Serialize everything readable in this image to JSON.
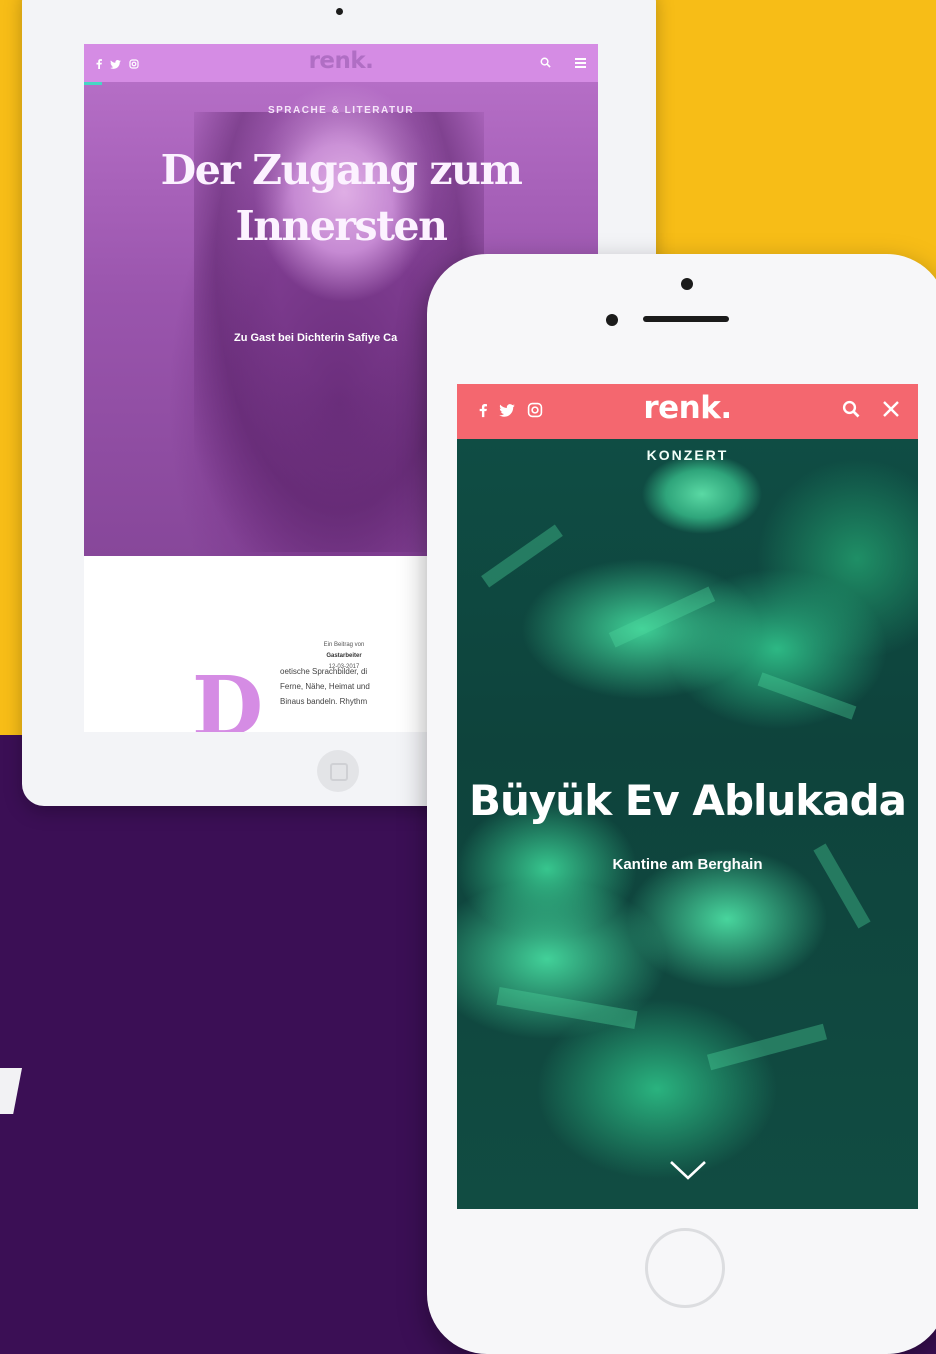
{
  "tablet": {
    "logo": "renk.",
    "category": "SPRACHE & LITERATUR",
    "title_line1": "Der Zugang zum",
    "title_line2": "Innersten",
    "subtitle": "Zu Gast bei Dichterin Safiye Ca",
    "meta_line1": "Ein Beitrag von",
    "meta_author": "Gastarbeiter",
    "meta_date": "12-03-2017",
    "drop_cap": "D",
    "body_line1": "oetische Sprachbilder, di",
    "body_line2": "Ferne, Nähe, Heimat und",
    "body_line3": "Binaus bandeln. Rhythm",
    "header_color": "#d58ce4"
  },
  "phone": {
    "logo": "renk.",
    "category": "KONZERT",
    "title": "Büyük Ev Ablukada",
    "subtitle": "Kantine am Berghain",
    "header_color": "#f4676f"
  },
  "icons": [
    "facebook-icon",
    "twitter-icon",
    "instagram-icon",
    "search-icon",
    "menu-icon",
    "close-icon",
    "chevron-down-icon"
  ]
}
